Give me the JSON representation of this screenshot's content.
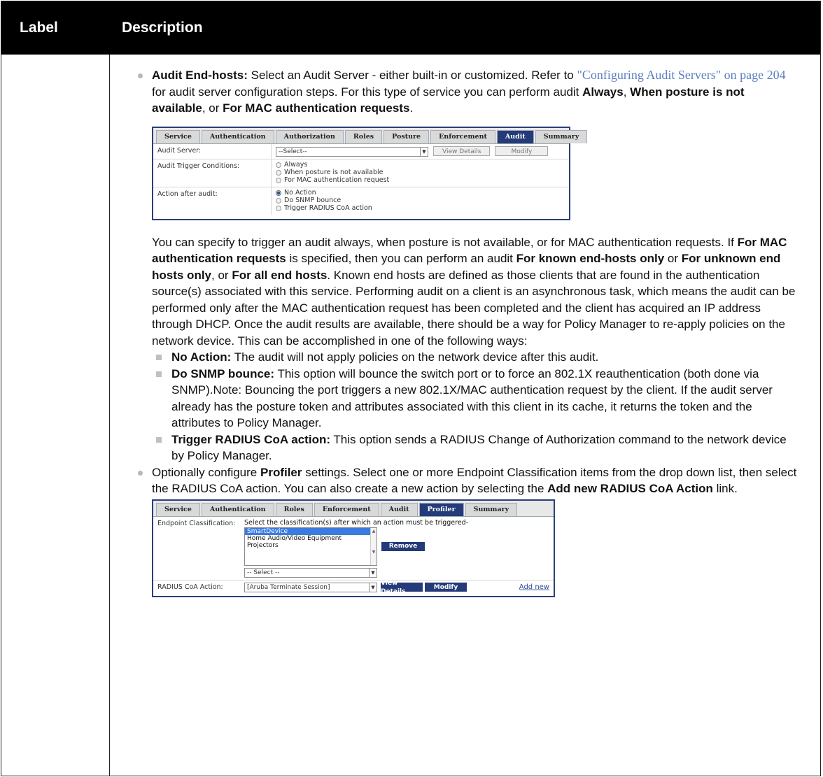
{
  "table": {
    "header_label": "Label",
    "header_description": "Description"
  },
  "audit_bullet": {
    "title": "Audit End-hosts:",
    "text1": " Select an Audit Server - either built-in or customized. Refer to ",
    "link": "\"Configuring Audit Servers\" on page 204",
    "text2": " for audit server configuration steps. For this type of service you can perform audit ",
    "opt1": "Always",
    "sep1": ", ",
    "opt2": "When posture is not available",
    "sep2": ", or ",
    "opt3": "For MAC authentication requests",
    "end": "."
  },
  "audit_shot": {
    "tabs": [
      "Service",
      "Authentication",
      "Authorization",
      "Roles",
      "Posture",
      "Enforcement",
      "Audit",
      "Summary"
    ],
    "active_tab": "Audit",
    "server_label": "Audit Server:",
    "server_select": "--Select--",
    "view_details": "View Details",
    "modify": "Modify",
    "trigger_label": "Audit Trigger Conditions:",
    "triggers": [
      "Always",
      "When posture is not available",
      "For MAC authentication request"
    ],
    "action_label": "Action after audit:",
    "actions": [
      "No Action",
      "Do SNMP bounce",
      "Trigger RADIUS CoA action"
    ],
    "selected_action": "No Action"
  },
  "audit_para": {
    "t1": "You can specify to trigger an audit always, when posture is not available, or for MAC authentication requests. If ",
    "b1": "For MAC authentication requests",
    "t2": " is specified, then you can perform an audit ",
    "b2": "For known end-hosts only",
    "t3": " or ",
    "b3": "For unknown end hosts only",
    "t4": ", or ",
    "b4": "For all end hosts",
    "t5": ". Known end hosts are defined as those clients that are found in the authentication source(s) associated with this service. Performing audit on a client is an asynchronous task, which means the audit can be performed only after the MAC authentication request has been completed and the client has acquired an IP address through DHCP. Once the audit results are available, there should be a way for Policy Manager to re-apply policies on the network device. This can be accomplished in one of the following ways:"
  },
  "sub_items": [
    {
      "title": "No Action:",
      "text": " The audit will not apply policies on the network device after this audit."
    },
    {
      "title": "Do SNMP bounce:",
      "text": " This option will bounce the switch port or to force an 802.1X reauthentication (both done via SNMP).Note: Bouncing the port triggers a new 802.1X/MAC authentication request by the client. If the audit server already has the posture token and attributes associated with this client in its cache, it returns the token and the attributes to Policy Manager."
    },
    {
      "title": "Trigger RADIUS CoA action:",
      "text": " This option sends a RADIUS Change of Authorization command to the network device by Policy Manager."
    }
  ],
  "profiler_bullet": {
    "t1": "Optionally configure ",
    "b1": "Profiler",
    "t2": " settings. Select one or more Endpoint Classification items from the drop down list, then select the RADIUS CoA action. You can also create a new action by selecting the ",
    "b2": "Add new RADIUS CoA Action",
    "t3": " link."
  },
  "profiler_shot": {
    "tabs": [
      "Service",
      "Authentication",
      "Roles",
      "Enforcement",
      "Audit",
      "Profiler",
      "Summary"
    ],
    "active_tab": "Profiler",
    "class_label": "Endpoint Classification:",
    "class_hint": "Select the classification(s) after which an action must be triggered-",
    "class_items": [
      "SmartDevice",
      "Home Audio/Video Equipment",
      "Projectors"
    ],
    "selected_item": "SmartDevice",
    "remove": "Remove",
    "class_select": "-- Select --",
    "coa_label": "RADIUS CoA Action:",
    "coa_select": "[Aruba Terminate Session]",
    "view_details": "View Details",
    "modify": "Modify",
    "add_new": "Add new"
  }
}
